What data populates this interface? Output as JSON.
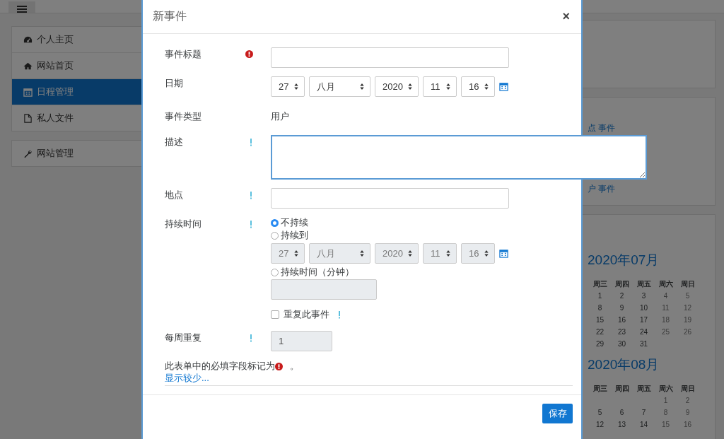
{
  "sidebar": {
    "items": [
      {
        "label": "个人主页",
        "selected": false
      },
      {
        "label": "网站首页",
        "selected": false
      },
      {
        "label": "日程管理",
        "selected": true
      },
      {
        "label": "私人文件",
        "selected": false
      }
    ],
    "admin_item": {
      "label": "网站管理",
      "selected": false
    }
  },
  "background_links": [
    "点 事件",
    "户 事件"
  ],
  "calendar": {
    "months": [
      {
        "title": "2020年07月",
        "weekdays": [
          "周三",
          "周四",
          "周五",
          "周六",
          "周日"
        ],
        "weeks": [
          [
            "1",
            "2",
            "3",
            "4",
            "5"
          ],
          [
            "8",
            "9",
            "10",
            "11",
            "12"
          ],
          [
            "15",
            "16",
            "17",
            "18",
            "19"
          ],
          [
            "22",
            "23",
            "24",
            "25",
            "26"
          ],
          [
            "29",
            "30",
            "31"
          ]
        ]
      },
      {
        "title": "2020年08月",
        "weekdays": [
          "周三",
          "周四",
          "周五",
          "周六",
          "周日"
        ],
        "weeks": [
          [
            "1",
            "2"
          ],
          [
            "5",
            "6",
            "7",
            "8",
            "9"
          ],
          [
            "12",
            "13",
            "14",
            "15",
            "16"
          ]
        ]
      }
    ]
  },
  "modal": {
    "title": "新事件",
    "close": "×",
    "fields": [
      {
        "kind": "text",
        "label": "事件标题",
        "required": true
      },
      {
        "kind": "datetime",
        "label": "日期",
        "selects": [
          "27",
          "八月",
          "2020",
          "11",
          "16"
        ],
        "disabled": false
      },
      {
        "kind": "static",
        "label": "事件类型",
        "value": "用户"
      },
      {
        "kind": "textarea",
        "label": "描述",
        "help": true
      },
      {
        "kind": "text",
        "label": "地点",
        "help": true
      },
      {
        "kind": "duration",
        "label": "持续时间",
        "help": true,
        "options": [
          {
            "label": "不持续",
            "selected": true
          },
          {
            "label": "持续到",
            "selected": false,
            "selects": [
              "27",
              "八月",
              "2020",
              "11",
              "16"
            ],
            "disabled": true
          },
          {
            "label": "持续时间（分钟）",
            "selected": false,
            "input_disabled": true
          }
        ]
      },
      {
        "kind": "checkbox",
        "label": "重复此事件",
        "checked": false,
        "help": true
      },
      {
        "kind": "number",
        "label": "每周重复",
        "help": true,
        "value": "1",
        "disabled": true
      }
    ],
    "required_note": [
      "此表单中的必填字段标记为",
      "。"
    ],
    "show_less": "显示较少...",
    "save": "保存"
  }
}
